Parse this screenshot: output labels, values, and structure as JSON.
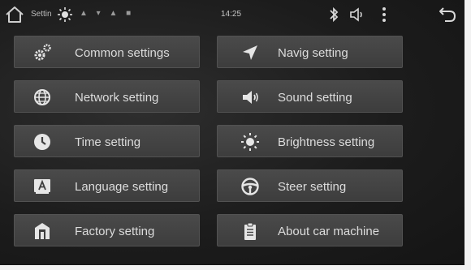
{
  "status_bar": {
    "app_label": "Settin",
    "time": "14:25",
    "notification_glyphs": "▲ ▾ ▲ ■",
    "icons": [
      "home-icon",
      "brightness-icon",
      "bluetooth-icon",
      "volume-icon",
      "more-vert-icon",
      "back-icon"
    ]
  },
  "menu": {
    "common": {
      "label": "Common settings",
      "icon": "gears-icon"
    },
    "navig": {
      "label": "Navig setting",
      "icon": "navigation-arrow-icon"
    },
    "network": {
      "label": "Network setting",
      "icon": "globe-icon"
    },
    "sound": {
      "label": "Sound setting",
      "icon": "speaker-icon"
    },
    "time": {
      "label": "Time setting",
      "icon": "clock-icon"
    },
    "brightness": {
      "label": "Brightness setting",
      "icon": "sun-icon"
    },
    "language": {
      "label": "Language setting",
      "icon": "language-icon"
    },
    "steer": {
      "label": "Steer setting",
      "icon": "steering-wheel-icon"
    },
    "factory": {
      "label": "Factory setting",
      "icon": "factory-icon"
    },
    "about": {
      "label": "About car machine",
      "icon": "clipboard-icon"
    }
  },
  "colors": {
    "background": "#1c1c1c",
    "tile": "#434343",
    "text": "#dcdcdc",
    "frame": "#f2f2f2"
  }
}
